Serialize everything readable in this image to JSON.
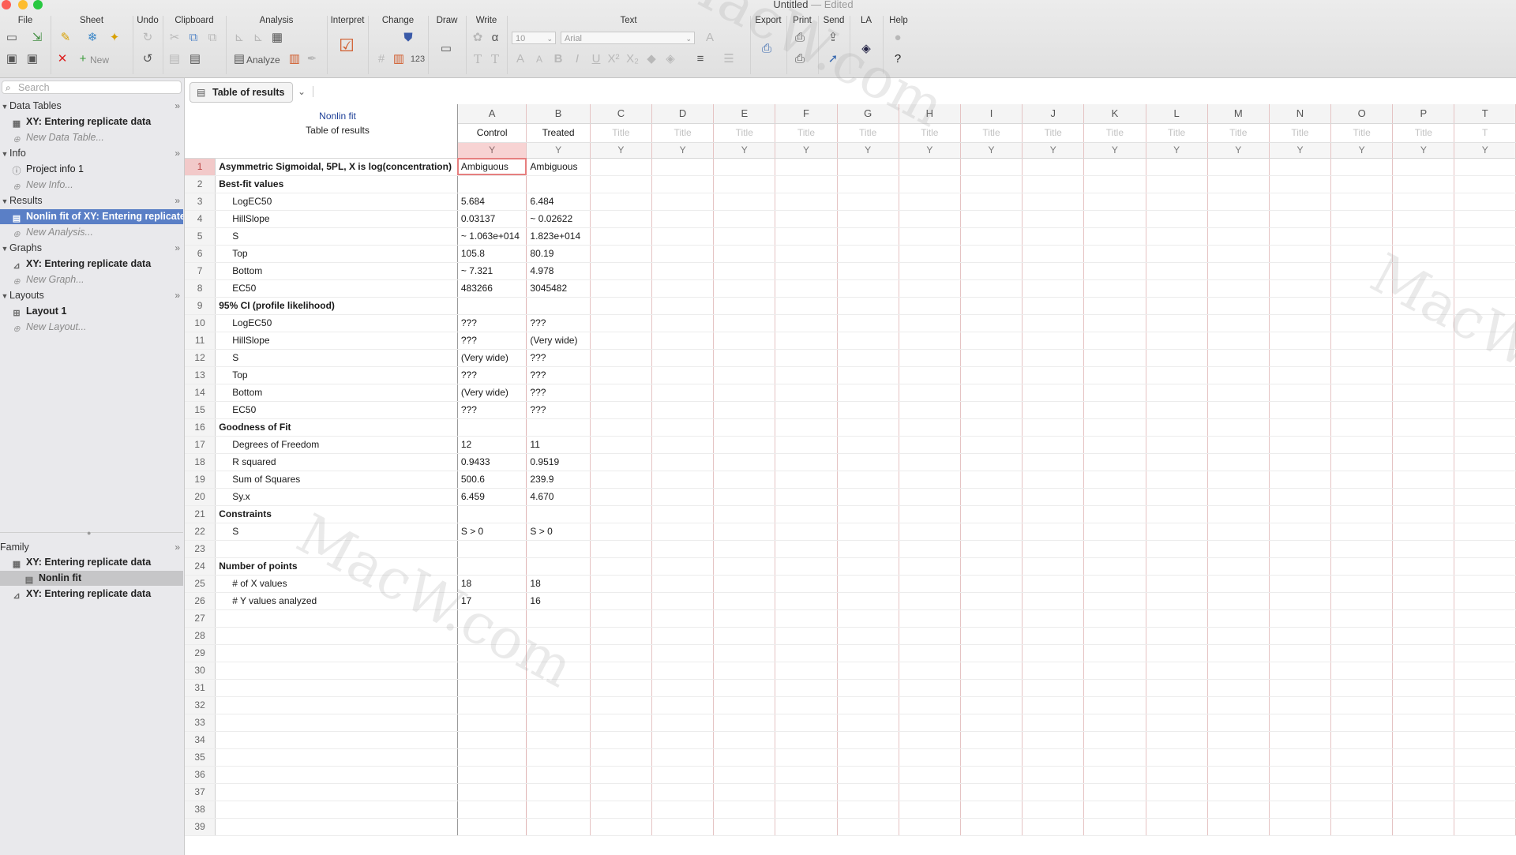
{
  "window": {
    "title": "Untitled",
    "edited": "— Edited"
  },
  "toolbar": {
    "groups": [
      "File",
      "Sheet",
      "Undo",
      "Clipboard",
      "Analysis",
      "Interpret",
      "Change",
      "Draw",
      "Write",
      "Text",
      "Export",
      "Print",
      "Send",
      "LA",
      "Help"
    ],
    "new_label": "New",
    "analyze_label": "Analyze",
    "font_size": "10",
    "font_name": "Arial"
  },
  "sidebar": {
    "search_placeholder": "Search",
    "sections": {
      "data_tables": "Data Tables",
      "info": "Info",
      "results": "Results",
      "graphs": "Graphs",
      "layouts": "Layouts",
      "family": "Family"
    },
    "data_tables_items": [
      "XY: Entering replicate data"
    ],
    "new_data_table": "New Data Table...",
    "info_items": [
      "Project info 1"
    ],
    "new_info": "New Info...",
    "results_items": [
      "Nonlin fit of XY: Entering replicate"
    ],
    "new_analysis": "New Analysis...",
    "graphs_items": [
      "XY: Entering replicate data"
    ],
    "new_graph": "New Graph...",
    "layouts_items": [
      "Layout 1"
    ],
    "new_layout": "New Layout...",
    "family_items": [
      "XY: Entering replicate data",
      "Nonlin fit",
      "XY: Entering replicate data"
    ]
  },
  "sheet": {
    "tab_label": "Table of results",
    "analysis_name": "Nonlin fit",
    "subtitle": "Table of results",
    "columns": [
      "A",
      "B",
      "C",
      "D",
      "E",
      "F",
      "G",
      "H",
      "I",
      "J",
      "K",
      "L",
      "M",
      "N",
      "O",
      "P",
      "T"
    ],
    "column_titles": [
      "Control",
      "Treated",
      "Title",
      "Title",
      "Title",
      "Title",
      "Title",
      "Title",
      "Title",
      "Title",
      "Title",
      "Title",
      "Title",
      "Title",
      "Title",
      "Title",
      "T"
    ],
    "y_label": "Y",
    "rows": [
      {
        "n": "1",
        "label": "Asymmetric Sigmoidal, 5PL, X is log(concentration)",
        "a": "Ambiguous",
        "b": "Ambiguous",
        "style": "b"
      },
      {
        "n": "2",
        "label": "Best-fit values",
        "a": "",
        "b": "",
        "style": "b"
      },
      {
        "n": "3",
        "label": "LogEC50",
        "a": "5.684",
        "b": "6.484",
        "style": "ind"
      },
      {
        "n": "4",
        "label": "HillSlope",
        "a": "0.03137",
        "b": "~ 0.02622",
        "style": "ind"
      },
      {
        "n": "5",
        "label": "S",
        "a": "~ 1.063e+014",
        "b": "1.823e+014",
        "style": "ind"
      },
      {
        "n": "6",
        "label": "Top",
        "a": "105.8",
        "b": "80.19",
        "style": "ind"
      },
      {
        "n": "7",
        "label": "Bottom",
        "a": "~ 7.321",
        "b": "4.978",
        "style": "ind"
      },
      {
        "n": "8",
        "label": "EC50",
        "a": "483266",
        "b": "3045482",
        "style": "ind"
      },
      {
        "n": "9",
        "label": "95% CI (profile likelihood)",
        "a": "",
        "b": "",
        "style": "b"
      },
      {
        "n": "10",
        "label": "LogEC50",
        "a": "???",
        "b": "???",
        "style": "ind"
      },
      {
        "n": "11",
        "label": "HillSlope",
        "a": "???",
        "b": "(Very wide)",
        "style": "ind"
      },
      {
        "n": "12",
        "label": "S",
        "a": "(Very wide)",
        "b": "???",
        "style": "ind"
      },
      {
        "n": "13",
        "label": "Top",
        "a": "???",
        "b": "???",
        "style": "ind"
      },
      {
        "n": "14",
        "label": "Bottom",
        "a": "(Very wide)",
        "b": "???",
        "style": "ind"
      },
      {
        "n": "15",
        "label": "EC50",
        "a": "???",
        "b": "???",
        "style": "ind"
      },
      {
        "n": "16",
        "label": "Goodness of Fit",
        "a": "",
        "b": "",
        "style": "b"
      },
      {
        "n": "17",
        "label": "Degrees of Freedom",
        "a": "12",
        "b": "11",
        "style": "ind"
      },
      {
        "n": "18",
        "label": "R squared",
        "a": "0.9433",
        "b": "0.9519",
        "style": "ind"
      },
      {
        "n": "19",
        "label": "Sum of Squares",
        "a": "500.6",
        "b": "239.9",
        "style": "ind"
      },
      {
        "n": "20",
        "label": "Sy.x",
        "a": "6.459",
        "b": "4.670",
        "style": "ind"
      },
      {
        "n": "21",
        "label": "Constraints",
        "a": "",
        "b": "",
        "style": "b"
      },
      {
        "n": "22",
        "label": "S",
        "a": "S > 0",
        "b": "S > 0",
        "style": "ind"
      },
      {
        "n": "23",
        "label": "",
        "a": "",
        "b": "",
        "style": ""
      },
      {
        "n": "24",
        "label": "Number of points",
        "a": "",
        "b": "",
        "style": "b"
      },
      {
        "n": "25",
        "label": "# of X values",
        "a": "18",
        "b": "18",
        "style": "ind"
      },
      {
        "n": "26",
        "label": "# Y values analyzed",
        "a": "17",
        "b": "16",
        "style": "ind"
      },
      {
        "n": "27",
        "label": "",
        "a": "",
        "b": "",
        "style": ""
      },
      {
        "n": "28",
        "label": "",
        "a": "",
        "b": "",
        "style": ""
      },
      {
        "n": "29",
        "label": "",
        "a": "",
        "b": "",
        "style": ""
      },
      {
        "n": "30",
        "label": "",
        "a": "",
        "b": "",
        "style": ""
      },
      {
        "n": "31",
        "label": "",
        "a": "",
        "b": "",
        "style": ""
      },
      {
        "n": "32",
        "label": "",
        "a": "",
        "b": "",
        "style": ""
      },
      {
        "n": "33",
        "label": "",
        "a": "",
        "b": "",
        "style": ""
      },
      {
        "n": "34",
        "label": "",
        "a": "",
        "b": "",
        "style": ""
      },
      {
        "n": "35",
        "label": "",
        "a": "",
        "b": "",
        "style": ""
      },
      {
        "n": "36",
        "label": "",
        "a": "",
        "b": "",
        "style": ""
      },
      {
        "n": "37",
        "label": "",
        "a": "",
        "b": "",
        "style": ""
      },
      {
        "n": "38",
        "label": "",
        "a": "",
        "b": "",
        "style": ""
      },
      {
        "n": "39",
        "label": "",
        "a": "",
        "b": "",
        "style": ""
      }
    ]
  },
  "watermark": "MacW.com",
  "colors": {
    "selection": "#5a7fc6",
    "selected_cell_border": "#e67f7f",
    "analysis_title": "#1d3f97"
  }
}
